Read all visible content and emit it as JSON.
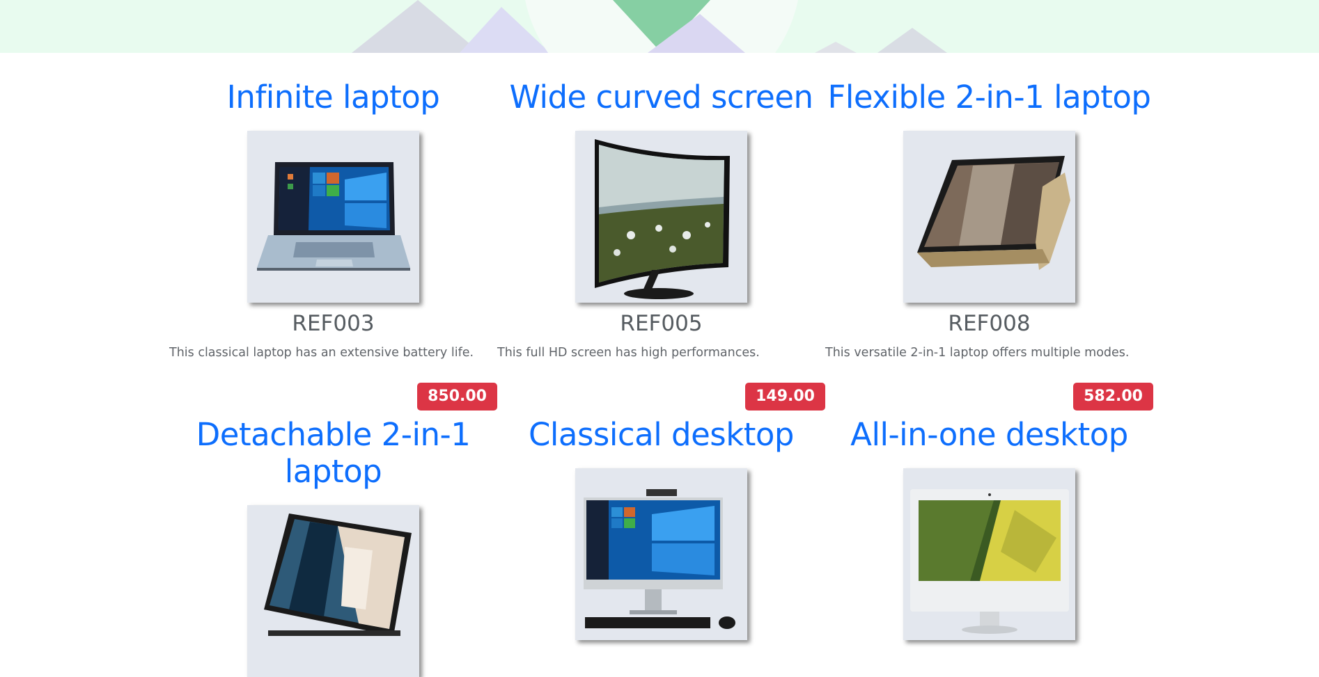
{
  "products": [
    {
      "title": "Infinite laptop",
      "ref": "REF003",
      "description": "This classical laptop has an extensive battery life.",
      "price": "850.00",
      "image": "laptop-image"
    },
    {
      "title": "Wide curved screen",
      "ref": "REF005",
      "description": "This full HD screen has high performances.",
      "price": "149.00",
      "image": "curved-monitor-image"
    },
    {
      "title": "Flexible 2-in-1 laptop",
      "ref": "REF008",
      "description": "This versatile 2-in-1 laptop offers multiple modes.",
      "price": "582.00",
      "image": "convertible-laptop-image"
    },
    {
      "title": "Detachable 2-in-1 laptop",
      "image": "detachable-tablet-image"
    },
    {
      "title": "Classical desktop",
      "image": "desktop-computer-image"
    },
    {
      "title": "All-in-one desktop",
      "image": "all-in-one-desktop-image"
    }
  ],
  "colors": {
    "title": "#0d6efd",
    "price_badge": "#dc3545",
    "thumb_bg": "#e3e7ee",
    "hero_bg": "#e9fbf0"
  }
}
